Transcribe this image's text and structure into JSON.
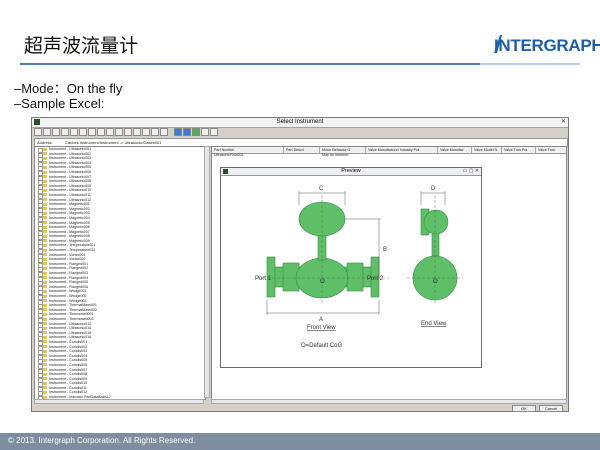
{
  "slide": {
    "title": "超声波流量计",
    "bullets": [
      "–Mode：On the fly",
      "–Sample Excel:"
    ],
    "logo": "INTERGRAPH",
    "footer": "© 2013. Intergraph Corporation. All Rights Reserved."
  },
  "window": {
    "title": "Select Instrument",
    "address_label": "Address:",
    "address_value": "Caches Instrument/Instrument -> Ultrasonic/Cases001",
    "ok_label": "OK",
    "cancel_label": "Cancel",
    "tree_items": [
      "Instrument - Ultrasonic001",
      "Instrument - Ultrasonic002",
      "Instrument - Ultrasonic003",
      "Instrument - Ultrasonic004",
      "Instrument - Ultrasonic005",
      "Instrument - Ultrasonic006",
      "Instrument - Ultrasonic007",
      "Instrument - Ultrasonic008",
      "Instrument - Ultrasonic009",
      "Instrument - Ultrasonic010",
      "Instrument - Ultrasonic011",
      "Instrument - Ultrasonic012",
      "Instrument - Magnetic001",
      "Instrument - Magnetic002",
      "Instrument - Magnetic003",
      "Instrument - Magnetic004",
      "Instrument - Magnetic005",
      "Instrument - Magnetic006",
      "Instrument - Magnetic007",
      "Instrument - Magnetic008",
      "Instrument - Magnetic009",
      "Instrument - Temperature001",
      "Instrument - Temperature002",
      "Instrument - Vortex001",
      "Instrument - Vortex002",
      "Instrument - Flanged001",
      "Instrument - Flanged002",
      "Instrument - Flanged003",
      "Instrument - Flanged004",
      "Instrument - Flanged005",
      "Instrument - Flanged006",
      "Instrument - Wedge001",
      "Instrument - Wedge002",
      "Instrument - Wedge003",
      "Instrument - ThermalMass001",
      "Instrument - ThermalMass002",
      "Instrument - Thermowell001",
      "Instrument - Thermowell002",
      "Instrument - Ultrasonic013",
      "Instrument - Ultrasonic014",
      "Instrument - Ultrasonic015",
      "Instrument - Ultrasonic016",
      "Instrument - Coriolis001",
      "Instrument - Coriolis002",
      "Instrument - Coriolis003",
      "Instrument - Coriolis004",
      "Instrument - Coriolis005",
      "Instrument - Coriolis006",
      "Instrument - Coriolis007",
      "Instrument - Coriolis008",
      "Instrument - Coriolis009",
      "Instrument - Coriolis010",
      "Instrument - Coriolis011",
      "Instrument - Coriolis012",
      "Instrument - Indicator PartDataBasis17"
    ],
    "grid_headers": [
      "Part Number",
      "Part Descri",
      "Mirror Behavior O",
      "Valve Manufacturer Industry Pra",
      "Valve Manufac",
      "Valve Model N",
      "Valve Trim Pra",
      "Valve Trim"
    ],
    "grid_row": [
      "UltrasonicFlow001",
      "",
      "Map be mirrored",
      "",
      "",
      "",
      "",
      ""
    ]
  },
  "preview": {
    "title": "Preview",
    "labels": {
      "c": "C",
      "d": "D",
      "b": "B",
      "a": "A",
      "o": "O",
      "port1": "Port 1",
      "port2": "Port 2",
      "front_view": "Front View",
      "end_view": "End View",
      "default_cog": "O=Default CoG"
    }
  },
  "colors": {
    "meter_green": "#5fbf68",
    "meter_stroke": "#3a8a44",
    "logo_blue": "#1c5fa8",
    "footer_bar": "#7f8da0"
  }
}
